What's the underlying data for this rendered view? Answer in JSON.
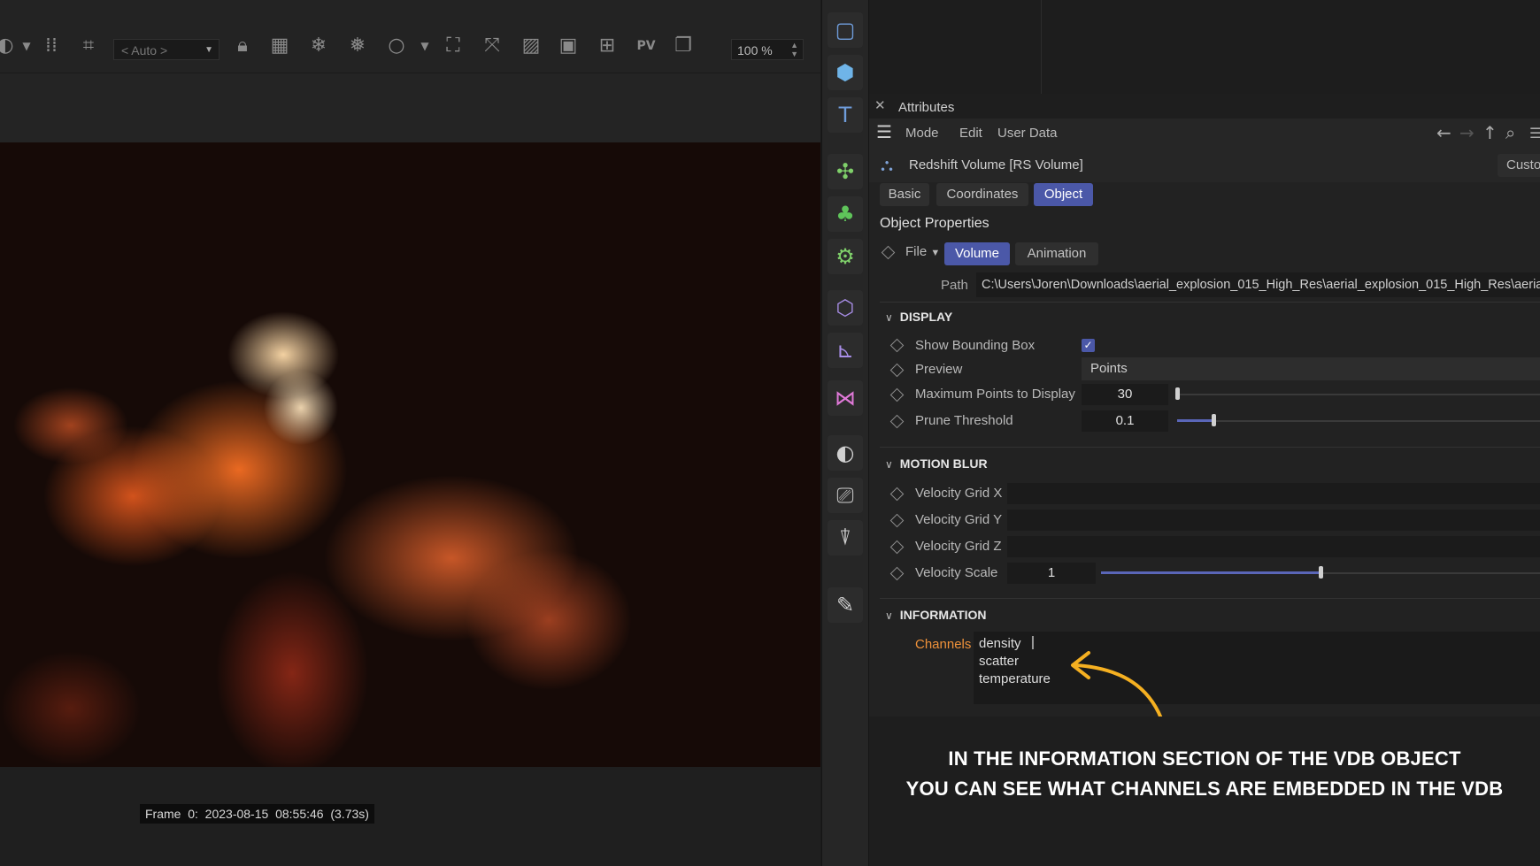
{
  "toolbar": {
    "auto_select_value": "< Auto >",
    "zoom_value": "100 %",
    "icons": [
      "bucket-icon",
      "dropdown-caret-icon",
      "grid-dots-icon",
      "crop-icon",
      "lock-icon",
      "grid-icon",
      "snowflake-icon",
      "snowflake-g-icon",
      "circle-icon",
      "dropdown-caret-icon",
      "region-icon",
      "fit-icon",
      "hatch-icon",
      "image-icon",
      "add-icon",
      "pv-icon",
      "copy-icon"
    ]
  },
  "render_view": {
    "frame_info": "Frame  0:  2023-08-15  08:55:46  (3.73s)"
  },
  "palette": {
    "tools": [
      {
        "name": "rectangle-tool-icon",
        "glyph": "▢",
        "color": "#6f9ddb"
      },
      {
        "name": "cube-tool-icon",
        "glyph": "⬢",
        "color": "#6fb4e8"
      },
      {
        "name": "text-tool-icon",
        "glyph": "T",
        "color": "#6f9ddb"
      },
      {
        "name": "generator-tool-icon",
        "glyph": "✣",
        "color": "#7fd06a"
      },
      {
        "name": "cloner-tool-icon",
        "glyph": "♣",
        "color": "#5fc45a"
      },
      {
        "name": "gear-tool-icon",
        "glyph": "⚙",
        "color": "#7fd06a"
      },
      {
        "name": "deformer-tool-icon",
        "glyph": "⬡",
        "color": "#a98ee8"
      },
      {
        "name": "transform-tool-icon",
        "glyph": "⊾",
        "color": "#a98ee8"
      },
      {
        "name": "effector-tool-icon",
        "glyph": "⋈",
        "color": "#e079d8"
      },
      {
        "name": "environment-tool-icon",
        "glyph": "◐",
        "color": "#d0d0d0"
      },
      {
        "name": "camera-tool-icon",
        "glyph": "⎚",
        "color": "#d0d0d0"
      },
      {
        "name": "light-tool-icon",
        "glyph": "⍒",
        "color": "#d0d0d0"
      },
      {
        "name": "edit-tool-icon",
        "glyph": "✎",
        "color": "#d0d0d0"
      }
    ]
  },
  "attributes": {
    "panel_title": "Attributes",
    "menu": {
      "mode": "Mode",
      "edit": "Edit",
      "user_data": "User Data"
    },
    "object_title": "Redshift Volume [RS Volume]",
    "custom_button": "Custo",
    "tabs": [
      {
        "label": "Basic",
        "active": false
      },
      {
        "label": "Coordinates",
        "active": false
      },
      {
        "label": "Object",
        "active": true
      }
    ],
    "section_title": "Object Properties",
    "file_label": "File",
    "sub_tabs": [
      {
        "label": "Volume",
        "active": true
      },
      {
        "label": "Animation",
        "active": false
      }
    ],
    "path_label": "Path",
    "path_value": "C:\\Users\\Joren\\Downloads\\aerial_explosion_015_High_Res\\aerial_explosion_015_High_Res\\aerial",
    "display": {
      "heading": "DISPLAY",
      "show_bounding_box": {
        "label": "Show Bounding Box",
        "checked": true
      },
      "preview": {
        "label": "Preview",
        "value": "Points"
      },
      "max_points": {
        "label": "Maximum Points to Display",
        "value": "30",
        "level": 0.0
      },
      "prune_threshold": {
        "label": "Prune Threshold",
        "value": "0.1",
        "level": 0.1
      }
    },
    "motion_blur": {
      "heading": "MOTION BLUR",
      "velocity_grid_x": {
        "label": "Velocity Grid X"
      },
      "velocity_grid_y": {
        "label": "Velocity Grid Y"
      },
      "velocity_grid_z": {
        "label": "Velocity Grid Z"
      },
      "velocity_scale": {
        "label": "Velocity Scale",
        "value": "1",
        "level": 0.5
      }
    },
    "information": {
      "heading": "INFORMATION",
      "channels_label": "Channels",
      "channels": [
        "density",
        "scatter",
        "temperature"
      ]
    }
  },
  "caption": {
    "line1": "IN THE INFORMATION SECTION OF THE VDB OBJECT",
    "line2": "YOU CAN SEE WHAT CHANNELS ARE EMBEDDED IN THE VDB"
  },
  "colors": {
    "accent": "#4b58a8",
    "channels_label": "#f0923a",
    "arrow": "#f5b021"
  }
}
